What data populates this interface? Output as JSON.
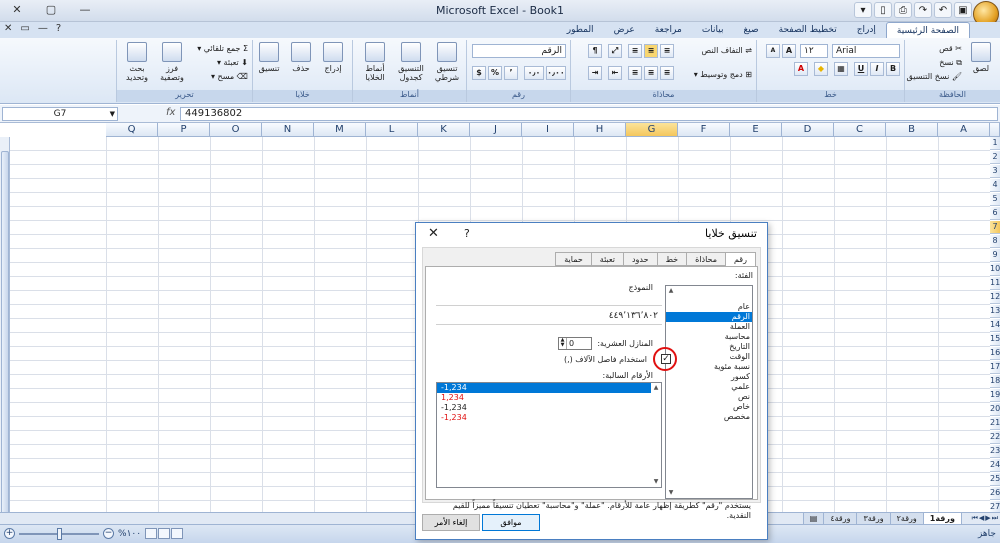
{
  "window": {
    "title": "Microsoft Excel - Book1",
    "controls": [
      "✕",
      "▢",
      "—"
    ]
  },
  "ribbon_tabs": [
    "الصفحة الرئيسية",
    "إدراج",
    "تخطيط الصفحة",
    "صيغ",
    "بيانات",
    "مراجعة",
    "عرض",
    "المطور"
  ],
  "ribbon_mini_controls": [
    "✕",
    "▭",
    "—",
    "?"
  ],
  "ribbon": {
    "clipboard": {
      "label": "الحافظة",
      "paste": "لصق",
      "cut": "قص",
      "copy": "نسخ",
      "format_painter": "نسخ التنسيق"
    },
    "font": {
      "label": "خط",
      "font_name": "Arial",
      "font_size": "١٢",
      "bold": "B",
      "italic": "I",
      "underline": "U",
      "grow": "A",
      "shrink": "A"
    },
    "alignment": {
      "label": "محاذاة",
      "wrap": "التفاف النص",
      "merge": "دمج وتوسيط"
    },
    "number": {
      "label": "رقم",
      "format": "الرقم",
      "percent": "%",
      "comma": "٬",
      "inc": "٠٫٠",
      "dec": "٠٫٠٠"
    },
    "styles": {
      "label": "أنماط",
      "conditional": "تنسيق شرطي",
      "as_table": "التنسيق كجدول",
      "cell_styles": "أنماط الخلايا"
    },
    "cells": {
      "label": "خلايا",
      "insert": "إدراج",
      "delete": "حذف",
      "format": "تنسيق"
    },
    "editing": {
      "label": "تحرير",
      "autosum": "جمع تلقائي",
      "fill": "تعبئة",
      "clear": "مسح",
      "sort": "فرز وتصفية",
      "find": "بحث وتحديد"
    }
  },
  "formula_bar": {
    "name_box": "G7",
    "fx": "fx",
    "content": "449136802"
  },
  "columns": [
    "A",
    "B",
    "C",
    "D",
    "E",
    "F",
    "G",
    "H",
    "I",
    "J",
    "K",
    "L",
    "M",
    "N",
    "O",
    "P",
    "Q"
  ],
  "selected_column": "G",
  "rows": [
    "1",
    "2",
    "3",
    "4",
    "5",
    "6",
    "7",
    "8",
    "9",
    "10",
    "11",
    "12",
    "13",
    "14",
    "15",
    "16",
    "17",
    "18",
    "19",
    "20",
    "21",
    "22",
    "23",
    "24",
    "25",
    "26",
    "27"
  ],
  "sheets": [
    "ورقة1",
    "ورقة٢",
    "ورقة٣",
    "ورقة٤"
  ],
  "active_sheet": "ورقة1",
  "status": {
    "zoom": "%١٠٠",
    "ready": "جاهز"
  },
  "dialog": {
    "title": "تنسيق خلايا",
    "help": "?",
    "close": "✕",
    "tabs": [
      "رقم",
      "محاذاة",
      "خط",
      "حدود",
      "تعبئة",
      "حماية"
    ],
    "active_tab": "رقم",
    "category_label": "الفئة:",
    "categories": [
      "عام",
      "الرقم",
      "العملة",
      "محاسبة",
      "التاريخ",
      "الوقت",
      "نسبة مئوية",
      "كسور",
      "علمي",
      "نص",
      "خاص",
      "مخصص"
    ],
    "selected_category": "الرقم",
    "sample_label": "النموذج",
    "sample_value": "٤٤٩٬١٣٦٬٨٠٢",
    "decimal_label": "المنازل العشرية:",
    "decimal_value": "0",
    "thousands_label": "استخدام فاصل الآلاف (,)",
    "thousands_checked": "✓",
    "negative_label": "الأرقام السالبة:",
    "negatives": [
      "-1,234",
      "1,234",
      "-1,234",
      "-1,234"
    ],
    "negative_colors": [
      "#ffffff",
      "#e01010",
      "#1e1e1e",
      "#e01010"
    ],
    "description": "يستخدم \"رقم\" كطريقة إظهار عامة للأرقام. \"عملة\" و\"محاسبة\" تعطيان تنسيقاً مميزاً للقيم النقدية.",
    "ok": "موافق",
    "cancel": "إلغاء الأمر"
  }
}
